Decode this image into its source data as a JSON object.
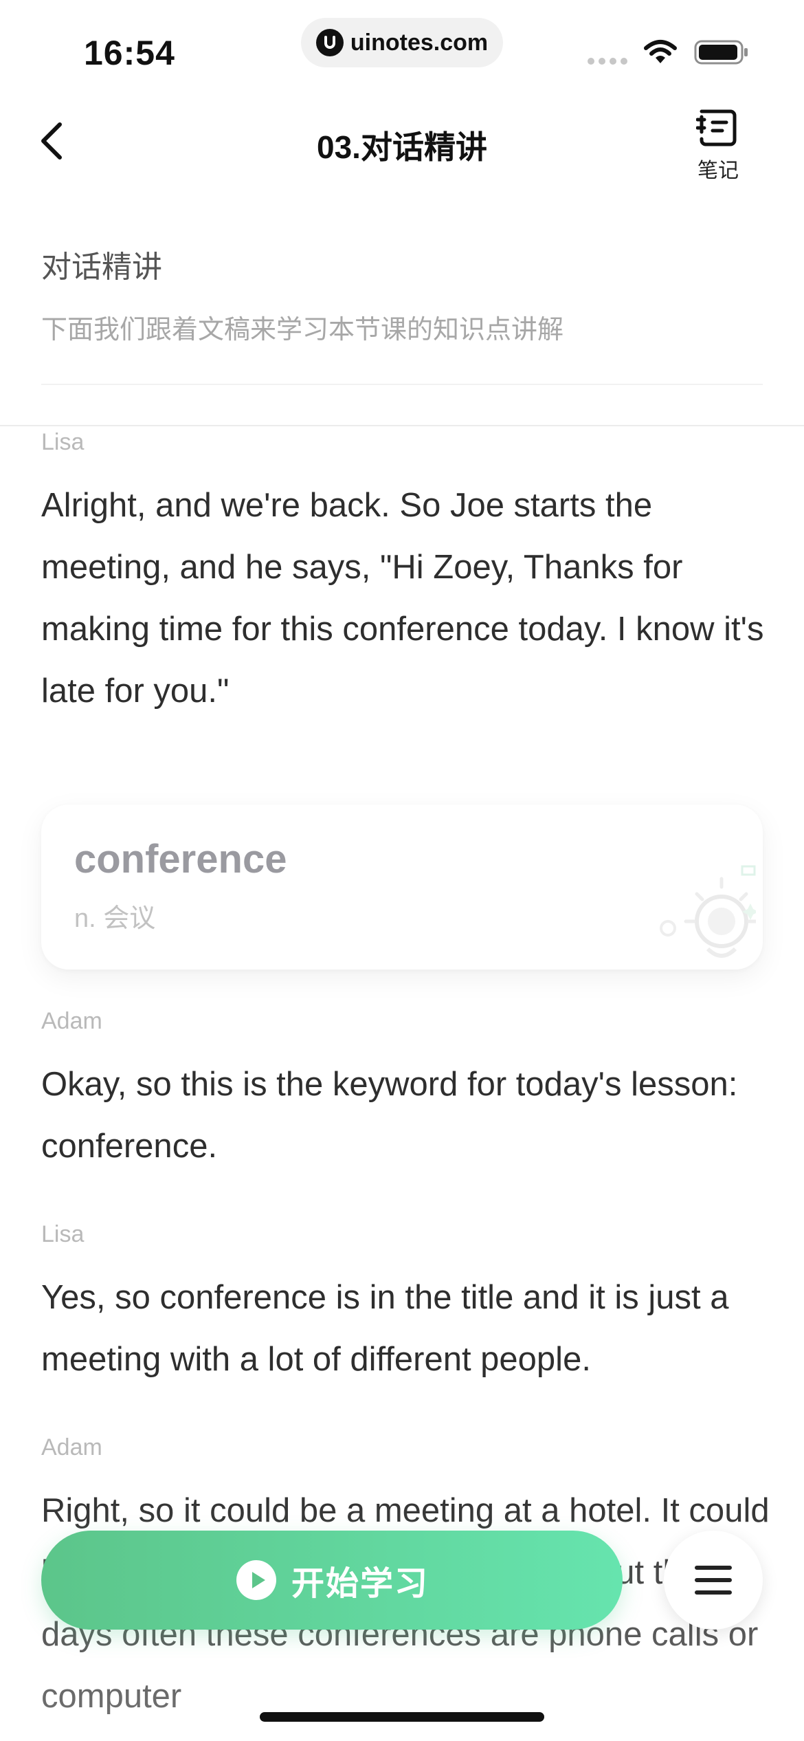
{
  "status_bar": {
    "time": "16:54",
    "url": "uinotes.com"
  },
  "nav": {
    "title": "03.对话精讲",
    "notes_label": "笔记"
  },
  "section": {
    "title": "对话精讲",
    "subtitle": "下面我们跟着文稿来学习本节课的知识点讲解"
  },
  "transcript": [
    {
      "speaker": "Lisa",
      "text": "Alright, and we're back. So Joe starts the meeting, and he says, \"Hi Zoey, Thanks for making time for this conference today. I know it's late for you.\""
    },
    {
      "speaker": "Adam",
      "text": "Okay, so this is the keyword for today's lesson: conference."
    },
    {
      "speaker": "Lisa",
      "text": "Yes, so conference is in the title and it is just a meeting with a lot of different people."
    },
    {
      "speaker": "Adam",
      "text": "Right, so it could be a meeting at a hotel. It could be a meeting at a conference center, but these days often these conferences are phone calls or computer"
    }
  ],
  "vocab": {
    "word": "conference",
    "definition": "n. 会议"
  },
  "bottom": {
    "start_label": "开始学习"
  },
  "colors": {
    "accent_start": "#5cc58a",
    "accent_end": "#66e4ae"
  }
}
